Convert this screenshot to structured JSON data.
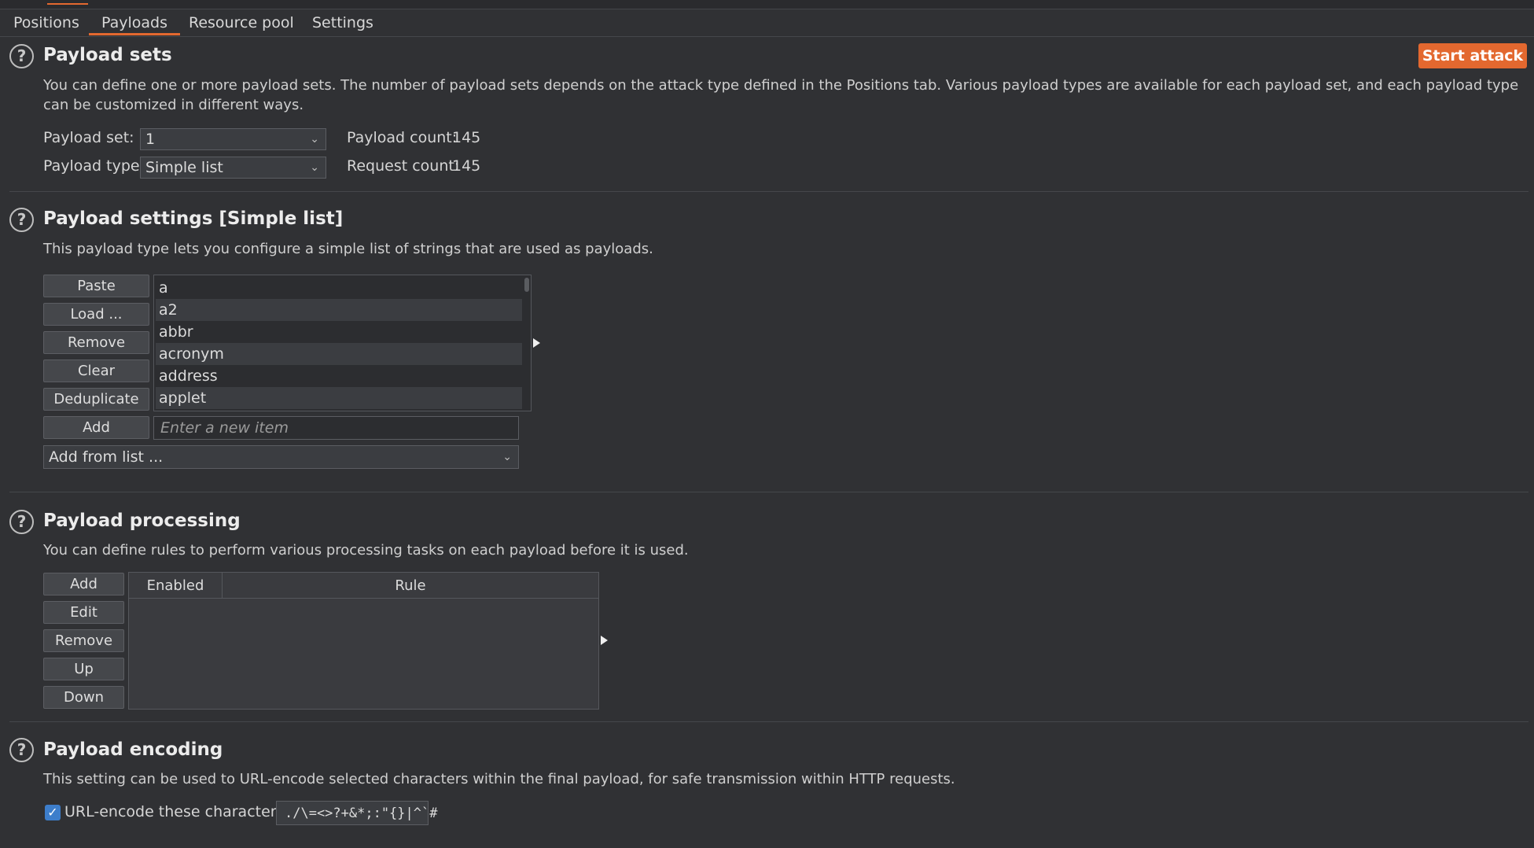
{
  "tabs": [
    {
      "label": "Positions"
    },
    {
      "label": "Payloads",
      "active": true
    },
    {
      "label": "Resource pool"
    },
    {
      "label": "Settings"
    }
  ],
  "accent_color": "#e3682f",
  "payload_sets": {
    "title": "Payload sets",
    "start_attack_label": "Start attack",
    "description": "You can define one or more payload sets. The number of payload sets depends on the attack type defined in the Positions tab. Various payload types are available for each payload set, and each payload type can be customized in different ways.",
    "payload_set_label": "Payload set:",
    "payload_set_value": "1",
    "payload_type_label": "Payload type:",
    "payload_type_value": "Simple list",
    "payload_count_label": "Payload count:",
    "payload_count_value": "145",
    "request_count_label": "Request count:",
    "request_count_value": "145"
  },
  "payload_settings": {
    "title": "Payload settings [Simple list]",
    "description": "This payload type lets you configure a simple list of strings that are used as payloads.",
    "buttons": {
      "paste": "Paste",
      "load": "Load ...",
      "remove": "Remove",
      "clear": "Clear",
      "deduplicate": "Deduplicate",
      "add": "Add"
    },
    "items": [
      "a",
      "a2",
      "abbr",
      "acronym",
      "address",
      "applet"
    ],
    "new_item_placeholder": "Enter a new item",
    "add_from_list_label": "Add from list ..."
  },
  "payload_processing": {
    "title": "Payload processing",
    "description": "You can define rules to perform various processing tasks on each payload before it is used.",
    "buttons": {
      "add": "Add",
      "edit": "Edit",
      "remove": "Remove",
      "up": "Up",
      "down": "Down"
    },
    "columns": [
      "Enabled",
      "Rule"
    ]
  },
  "payload_encoding": {
    "title": "Payload encoding",
    "description": "This setting can be used to URL-encode selected characters within the final payload, for safe transmission within HTTP requests.",
    "checkbox_label": "URL-encode these characters:",
    "checked": true,
    "characters": "./\\=<>?+&*;:\"{}|^`#"
  },
  "icons": {
    "help": "help-circle-icon",
    "dropdown": "chevron-down-icon",
    "expand": "triangle-right-icon",
    "check": "check-icon"
  }
}
